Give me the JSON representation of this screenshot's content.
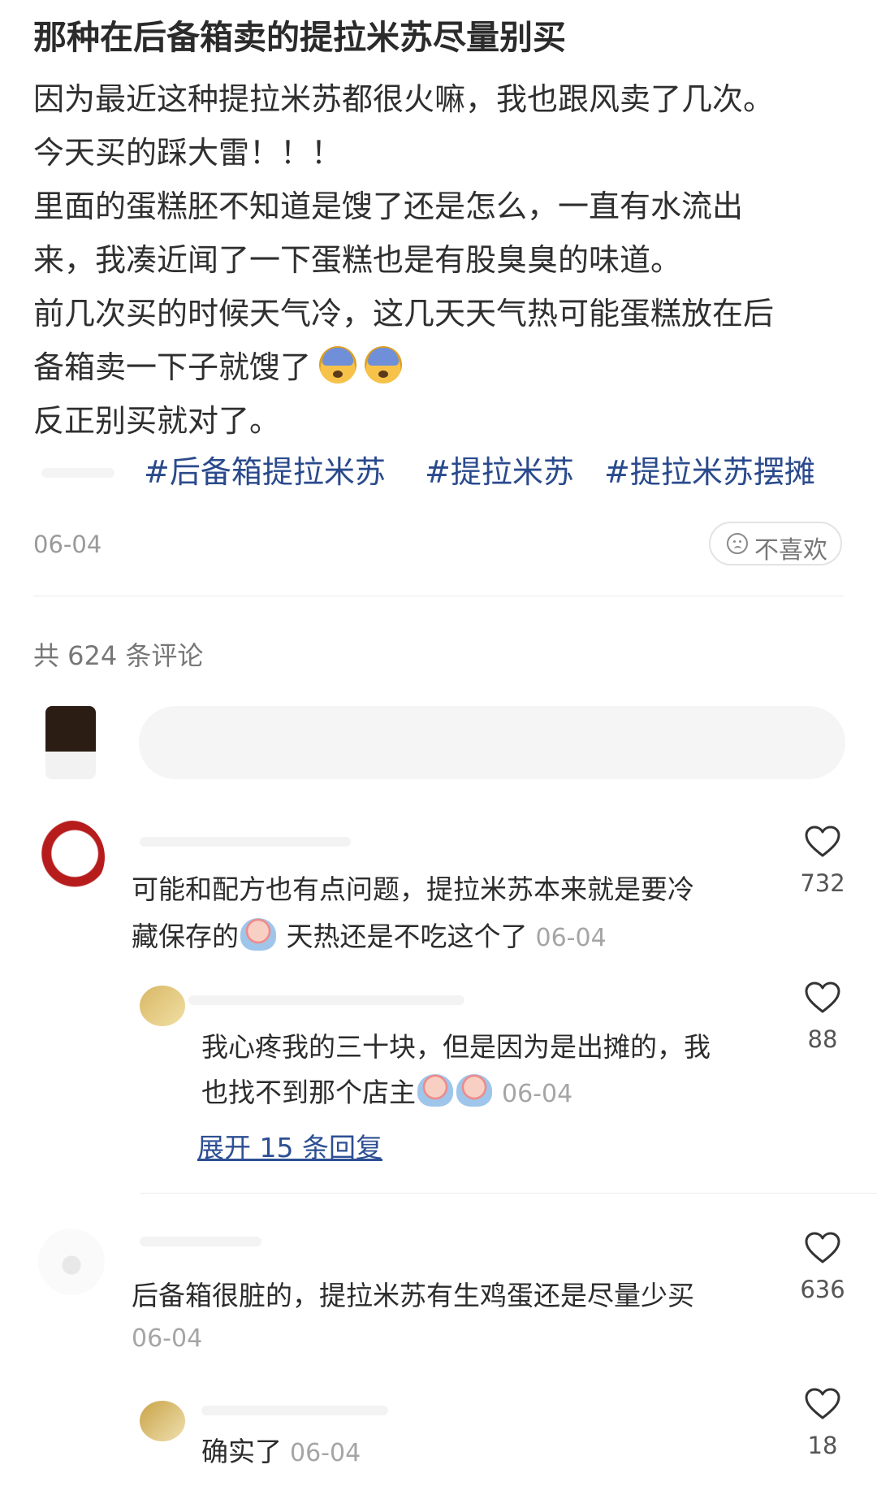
{
  "post": {
    "title": "那种在后备箱卖的提拉米苏尽量别买",
    "body_lines": [
      "因为最近这种提拉米苏都很火嘛，我也跟风卖了几次。",
      "今天买的踩大雷！！！",
      "里面的蛋糕胚不知道是馊了还是怎么，一直有水流出",
      "来，我凑近闻了一下蛋糕也是有股臭臭的味道。",
      "前几次买的时候天气冷，这几天天气热可能蛋糕放在后",
      "备箱卖一下子就馊了",
      "反正别买就对了。"
    ],
    "tags": [
      "#后备箱提拉米苏",
      "#提拉米苏",
      "#提拉米苏摆摊"
    ],
    "date": "06-04",
    "dislike_label": "不喜欢"
  },
  "comments": {
    "count_label": "共 624 条评论",
    "input_placeholder": "",
    "items": [
      {
        "text_lines": [
          "可能和配方也有点问题，提拉米苏本来就是要冷",
          "藏保存的",
          " 天热还是不吃这个了"
        ],
        "date": "06-04",
        "likes": "732",
        "replies": [
          {
            "text_lines": [
              "我心疼我的三十块，但是因为是出摊的，我",
              "也找不到那个店主"
            ],
            "date": "06-04",
            "likes": "88"
          }
        ],
        "expand_label": "展开 15 条回复"
      },
      {
        "text_lines": [
          "后备箱很脏的，提拉米苏有生鸡蛋还是尽量少买"
        ],
        "date": "06-04",
        "likes": "636",
        "replies": [
          {
            "text_lines": [
              "确实了"
            ],
            "date": "06-04",
            "likes": "18"
          }
        ]
      }
    ]
  },
  "icons": {
    "heart": "heart-outline-icon",
    "dislike": "sad-face-icon",
    "emoji": "fearful-face-emoji",
    "sticker": "crying-sticker"
  }
}
